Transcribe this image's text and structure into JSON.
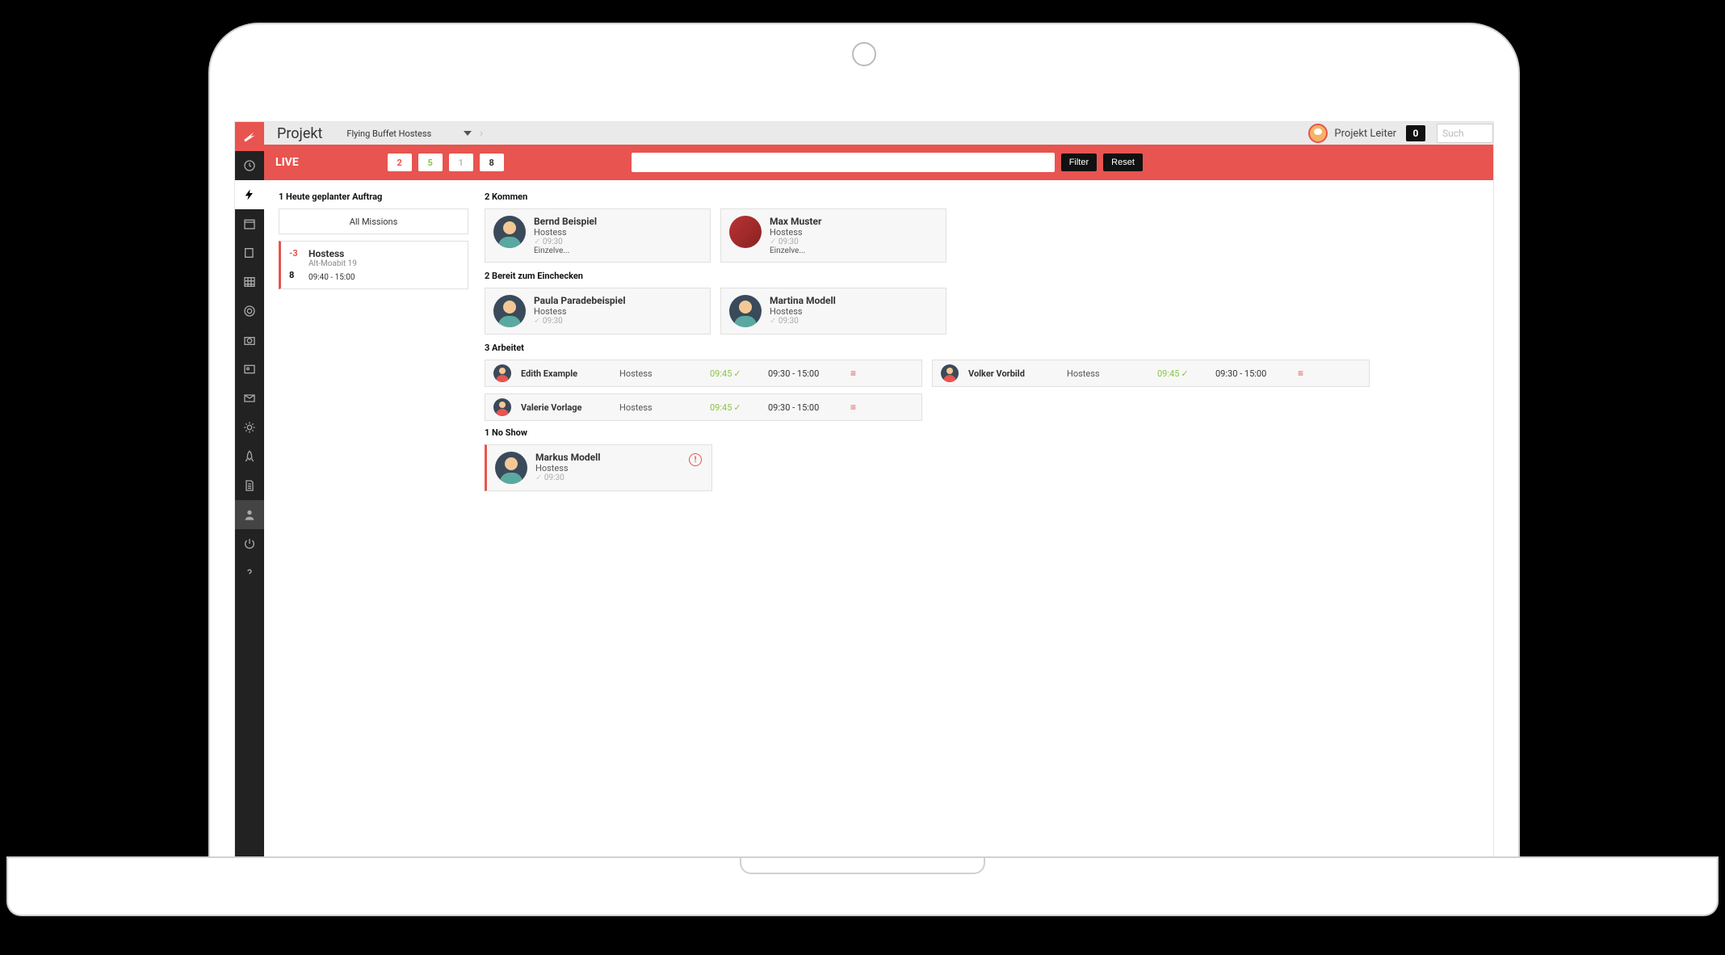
{
  "topbar": {
    "title": "Projekt",
    "project_name": "Flying Buffet Hostess",
    "username": "Projekt Leiter",
    "badge": "0",
    "search_placeholder": "Such"
  },
  "live": {
    "label": "LIVE",
    "counts": {
      "red": "2",
      "green": "5",
      "grey": "1",
      "dark": "8"
    },
    "filter_btn": "Filter",
    "reset_btn": "Reset"
  },
  "left": {
    "heading": "1 Heute geplanter Auftrag",
    "all_missions": "All Missions",
    "mission": {
      "neg": "-3",
      "pos": "8",
      "name": "Hostess",
      "location": "Alt-Moabit 19",
      "time": "09:40 - 15:00"
    }
  },
  "sections": {
    "kommen": {
      "title": "2 Kommen",
      "cards": [
        {
          "name": "Bernd Beispiel",
          "role": "Hostess",
          "time": "09:30",
          "extra": "Einzelve..."
        },
        {
          "name": "Max Muster",
          "role": "Hostess",
          "time": "09:30",
          "extra": "Einzelve...",
          "photo": true
        }
      ]
    },
    "bereit": {
      "title": "2 Bereit zum Einchecken",
      "cards": [
        {
          "name": "Paula Paradebeispiel",
          "role": "Hostess",
          "time": "09:30"
        },
        {
          "name": "Martina Modell",
          "role": "Hostess",
          "time": "09:30"
        }
      ]
    },
    "arbeitet": {
      "title": "3 Arbeitet",
      "rows": [
        {
          "name": "Edith Example",
          "role": "Hostess",
          "checkin": "09:45",
          "range": "09:30 - 15:00"
        },
        {
          "name": "Volker Vorbild",
          "role": "Hostess",
          "checkin": "09:45",
          "range": "09:30 - 15:00"
        },
        {
          "name": "Valerie Vorlage",
          "role": "Hostess",
          "checkin": "09:45",
          "range": "09:30 - 15:00"
        }
      ]
    },
    "noshow": {
      "title": "1 No Show",
      "cards": [
        {
          "name": "Markus Modell",
          "role": "Hostess",
          "time": "09:30"
        }
      ]
    }
  }
}
